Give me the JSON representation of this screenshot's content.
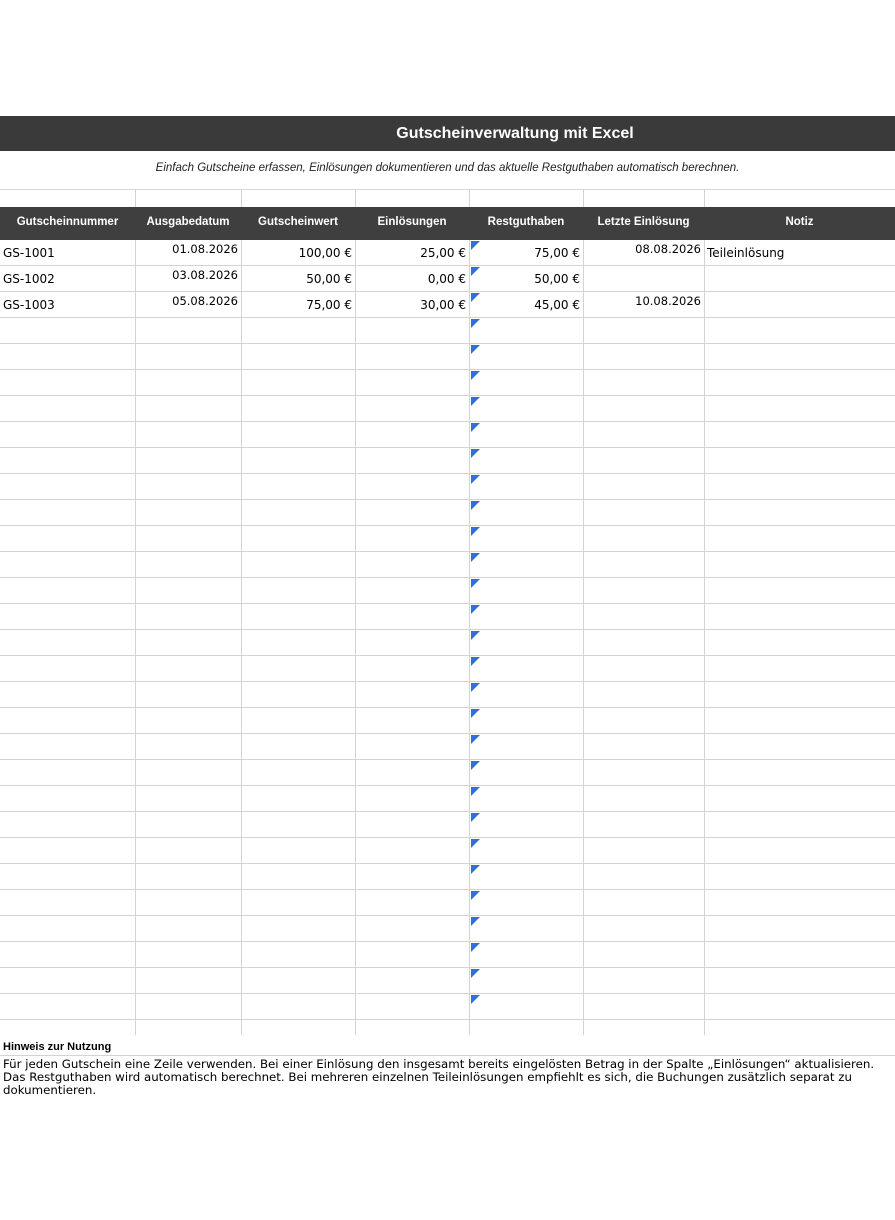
{
  "title": "Gutscheinverwaltung mit Excel",
  "subtitle": "Einfach Gutscheine erfassen, Einlösungen dokumentieren und das aktuelle Restguthaben automatisch berechnen.",
  "columns": [
    "Gutscheinnummer",
    "Ausgabedatum",
    "Gutscheinwert",
    "Einlösungen",
    "Restguthaben",
    "Letzte Einlösung",
    "Notiz"
  ],
  "rows": [
    {
      "id": "GS-1001",
      "date": "01.08.2026",
      "value": "100,00 €",
      "redeemed": "25,00 €",
      "balance": "75,00 €",
      "last": "08.08.2026",
      "note": "Teileinlösung"
    },
    {
      "id": "GS-1002",
      "date": "03.08.2026",
      "value": "50,00 €",
      "redeemed": "0,00 €",
      "balance": "50,00 €",
      "last": "",
      "note": ""
    },
    {
      "id": "GS-1003",
      "date": "05.08.2026",
      "value": "75,00 €",
      "redeemed": "30,00 €",
      "balance": "45,00 €",
      "last": "10.08.2026",
      "note": ""
    }
  ],
  "empty_rows": 27,
  "flag_color": "#2f6fe0",
  "header_color": "#3f3f3f",
  "hint": {
    "title": "Hinweis zur Nutzung",
    "text": "Für jeden Gutschein eine Zeile verwenden. Bei einer Einlösung den insgesamt bereits eingelösten Betrag in der Spalte „Einlösungen“ aktualisieren. Das Restguthaben wird automatisch berechnet. Bei mehreren einzelnen Teileinlösungen empfiehlt es sich, die Buchungen zusätzlich separat zu dokumentieren."
  }
}
